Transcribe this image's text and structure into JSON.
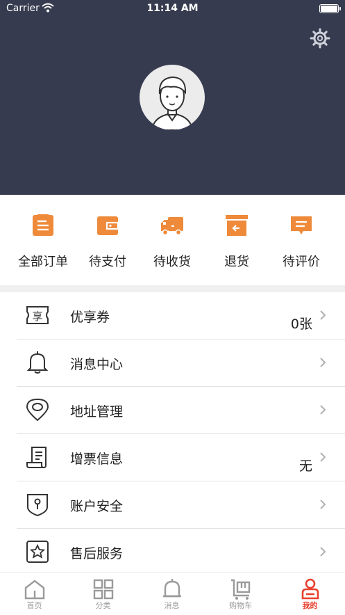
{
  "status_bar": {
    "carrier": "Carrier",
    "time": "11:14 AM"
  },
  "header": {
    "settings_icon": "gear-icon",
    "avatar_icon": "user-avatar"
  },
  "orders": [
    {
      "label": "全部订单",
      "icon": "clipboard-icon"
    },
    {
      "label": "待支付",
      "icon": "wallet-icon"
    },
    {
      "label": "待收货",
      "icon": "truck-icon"
    },
    {
      "label": "退货",
      "icon": "return-box-icon"
    },
    {
      "label": "待评价",
      "icon": "comment-icon"
    }
  ],
  "menu": [
    {
      "label": "优享券",
      "value": "0张",
      "icon": "coupon-icon"
    },
    {
      "label": "消息中心",
      "value": "",
      "icon": "bell-icon"
    },
    {
      "label": "地址管理",
      "value": "",
      "icon": "location-icon"
    },
    {
      "label": "增票信息",
      "value": "无",
      "icon": "invoice-icon"
    },
    {
      "label": "账户安全",
      "value": "",
      "icon": "shield-icon"
    },
    {
      "label": "售后服务",
      "value": "",
      "icon": "service-icon"
    }
  ],
  "tabbar": [
    {
      "label": "首页",
      "icon": "home-icon",
      "active": false
    },
    {
      "label": "分类",
      "icon": "grid-icon",
      "active": false
    },
    {
      "label": "消息",
      "icon": "bell-icon",
      "active": false
    },
    {
      "label": "购物车",
      "icon": "cart-icon",
      "active": false
    },
    {
      "label": "我的",
      "icon": "person-icon",
      "active": true
    }
  ],
  "colors": {
    "header": "#363b4f",
    "accent_orange": "#ee8a3a",
    "active_tab": "#e8402f",
    "divider": "#f0f0f0"
  }
}
